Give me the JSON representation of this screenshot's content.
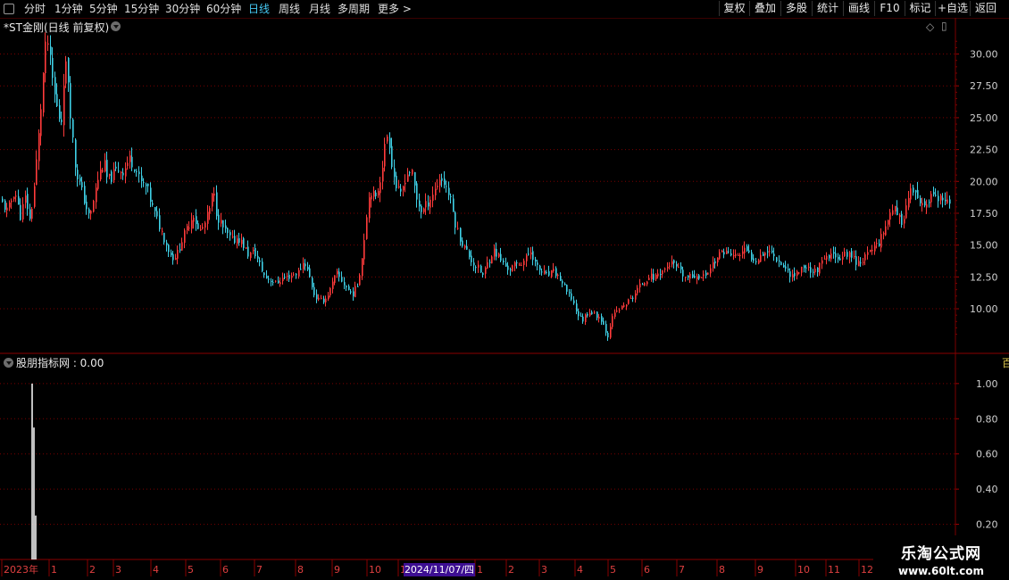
{
  "toolbar": {
    "periods": [
      "分时",
      "1分钟",
      "5分钟",
      "15分钟",
      "30分钟",
      "60分钟",
      "日线",
      "周线",
      "月线",
      "多周期",
      "更多 >"
    ],
    "active_period": "日线",
    "buttons": [
      "复权",
      "叠加",
      "多股",
      "统计",
      "画线",
      "F10",
      "标记",
      "+自选",
      "返回"
    ]
  },
  "main_panel": {
    "title": "*ST金刚(日线 前复权)"
  },
  "indicator_panel": {
    "title": "股朋指标网 : 0.00"
  },
  "right_strip": {
    "text": "百"
  },
  "time_axis": {
    "highlight": "2024/11/07/四"
  },
  "watermark": {
    "title": "乐淘公式网",
    "url": "www.60lt.com"
  },
  "colors": {
    "up": "#ff3b3b",
    "down": "#3fd0e6",
    "grid": "#7a0000",
    "axis_text": "#d0d0d0",
    "active": "#45c8f3"
  },
  "chart_data": [
    {
      "type": "candlestick",
      "title": "*ST金刚(日线 前复权)",
      "y_ticks": [
        10.0,
        12.5,
        15.0,
        17.5,
        20.0,
        22.5,
        25.0,
        27.5,
        30.0
      ],
      "ylim": [
        6.5,
        32
      ],
      "x_ticks": [
        "2023年",
        "1",
        "2",
        "3",
        "4",
        "5",
        "6",
        "7",
        "8",
        "9",
        "10",
        "1",
        "2024/11/07/四",
        "1",
        "2",
        "3",
        "4",
        "5",
        "6",
        "7",
        "8",
        "9",
        "10",
        "11",
        "12"
      ],
      "close_path": [
        [
          0,
          18.5
        ],
        [
          8,
          17.6
        ],
        [
          16,
          19.4
        ],
        [
          22,
          17.2
        ],
        [
          28,
          18.8
        ],
        [
          33,
          16.8
        ],
        [
          38,
          19.8
        ],
        [
          44,
          24.5
        ],
        [
          48,
          28.5
        ],
        [
          52,
          31.5
        ],
        [
          56,
          29
        ],
        [
          60,
          27
        ],
        [
          64,
          25.5
        ],
        [
          68,
          24.5
        ],
        [
          72,
          29.5
        ],
        [
          76,
          28
        ],
        [
          80,
          24
        ],
        [
          84,
          21
        ],
        [
          90,
          19.5
        ],
        [
          96,
          18
        ],
        [
          100,
          17
        ],
        [
          104,
          18.5
        ],
        [
          110,
          20.5
        ],
        [
          116,
          21.5
        ],
        [
          120,
          20
        ],
        [
          126,
          20.5
        ],
        [
          132,
          21
        ],
        [
          138,
          20.8
        ],
        [
          144,
          21.8
        ],
        [
          150,
          21.3
        ],
        [
          156,
          20
        ],
        [
          164,
          19.5
        ],
        [
          170,
          18
        ],
        [
          178,
          16.5
        ],
        [
          186,
          15
        ],
        [
          192,
          14
        ],
        [
          198,
          14.3
        ],
        [
          204,
          15.5
        ],
        [
          210,
          16.5
        ],
        [
          216,
          17.5
        ],
        [
          222,
          16
        ],
        [
          228,
          16.5
        ],
        [
          234,
          17.8
        ],
        [
          238,
          19.3
        ],
        [
          242,
          17.5
        ],
        [
          248,
          16.5
        ],
        [
          254,
          15.8
        ],
        [
          260,
          15.3
        ],
        [
          266,
          15.6
        ],
        [
          272,
          15
        ],
        [
          278,
          14.2
        ],
        [
          284,
          14.5
        ],
        [
          290,
          13.5
        ],
        [
          296,
          12.5
        ],
        [
          302,
          12.3
        ],
        [
          308,
          12
        ],
        [
          316,
          12.4
        ],
        [
          322,
          12.5
        ],
        [
          328,
          12.7
        ],
        [
          334,
          12.9
        ],
        [
          340,
          13.8
        ],
        [
          346,
          12.5
        ],
        [
          352,
          11
        ],
        [
          358,
          10.6
        ],
        [
          364,
          10.8
        ],
        [
          370,
          11.6
        ],
        [
          376,
          12.8
        ],
        [
          382,
          12.2
        ],
        [
          388,
          11.6
        ],
        [
          394,
          11.1
        ],
        [
          400,
          11.9
        ],
        [
          406,
          14.5
        ],
        [
          410,
          17.5
        ],
        [
          414,
          19.5
        ],
        [
          420,
          18.5
        ],
        [
          426,
          20.5
        ],
        [
          430,
          22.5
        ],
        [
          434,
          24
        ],
        [
          438,
          21.5
        ],
        [
          442,
          19.8
        ],
        [
          448,
          18.8
        ],
        [
          454,
          20.5
        ],
        [
          460,
          20.9
        ],
        [
          466,
          18.6
        ],
        [
          472,
          17.6
        ],
        [
          478,
          18.3
        ],
        [
          486,
          19.3
        ],
        [
          492,
          20.3
        ],
        [
          498,
          19.8
        ],
        [
          504,
          18.6
        ],
        [
          510,
          16.5
        ],
        [
          516,
          15.3
        ],
        [
          522,
          14.5
        ],
        [
          530,
          13.5
        ],
        [
          536,
          13.1
        ],
        [
          540,
          12.6
        ],
        [
          546,
          13.7
        ],
        [
          552,
          14.6
        ],
        [
          558,
          14.1
        ],
        [
          564,
          13.4
        ],
        [
          570,
          13.1
        ],
        [
          576,
          13.4
        ],
        [
          582,
          13.6
        ],
        [
          588,
          13.9
        ],
        [
          594,
          14.6
        ],
        [
          600,
          13.3
        ],
        [
          606,
          12.9
        ],
        [
          612,
          12.6
        ],
        [
          620,
          12.9
        ],
        [
          628,
          12.2
        ],
        [
          634,
          11.3
        ],
        [
          640,
          10.8
        ],
        [
          646,
          9.6
        ],
        [
          652,
          9.1
        ],
        [
          656,
          9.6
        ],
        [
          660,
          9.8
        ],
        [
          666,
          9.5
        ],
        [
          672,
          9.3
        ],
        [
          676,
          8.6
        ],
        [
          680,
          7.8
        ],
        [
          684,
          9.1
        ],
        [
          690,
          9.8
        ],
        [
          696,
          10.1
        ],
        [
          702,
          10.5
        ],
        [
          708,
          10.9
        ],
        [
          714,
          11.6
        ],
        [
          720,
          12.1
        ],
        [
          726,
          12.6
        ],
        [
          732,
          12.4
        ],
        [
          738,
          12.9
        ],
        [
          744,
          13.1
        ],
        [
          750,
          13.6
        ],
        [
          756,
          13.3
        ],
        [
          762,
          12.8
        ],
        [
          768,
          12.4
        ],
        [
          774,
          12.5
        ],
        [
          780,
          12.7
        ],
        [
          786,
          12.4
        ],
        [
          792,
          12.9
        ],
        [
          798,
          13.6
        ],
        [
          804,
          14.1
        ],
        [
          810,
          14.6
        ],
        [
          816,
          14.3
        ],
        [
          822,
          14.1
        ],
        [
          828,
          14.3
        ],
        [
          834,
          14.6
        ],
        [
          840,
          14.1
        ],
        [
          846,
          13.9
        ],
        [
          852,
          14.3
        ],
        [
          858,
          14.6
        ],
        [
          864,
          14.4
        ],
        [
          870,
          13.9
        ],
        [
          876,
          13.4
        ],
        [
          882,
          12.9
        ],
        [
          888,
          12.6
        ],
        [
          894,
          12.9
        ],
        [
          900,
          13.4
        ],
        [
          906,
          13.1
        ],
        [
          912,
          12.9
        ],
        [
          918,
          13.4
        ],
        [
          924,
          13.9
        ],
        [
          930,
          14.1
        ],
        [
          936,
          14.3
        ],
        [
          942,
          13.9
        ],
        [
          948,
          14.4
        ],
        [
          954,
          14.1
        ],
        [
          960,
          13.6
        ],
        [
          966,
          13.9
        ],
        [
          972,
          14.3
        ],
        [
          978,
          14.9
        ],
        [
          984,
          15.3
        ],
        [
          990,
          16.3
        ],
        [
          996,
          17.5
        ],
        [
          1000,
          18.2
        ],
        [
          1004,
          17.1
        ],
        [
          1010,
          16.9
        ],
        [
          1016,
          18.5
        ],
        [
          1020,
          19.3
        ],
        [
          1026,
          18.6
        ],
        [
          1032,
          17.9
        ],
        [
          1038,
          18.3
        ],
        [
          1044,
          18.9
        ],
        [
          1050,
          18.6
        ],
        [
          1056,
          18.4
        ],
        [
          1062,
          18.1
        ],
        [
          1065,
          17.6
        ]
      ],
      "up_color": "#ff3b3b",
      "down_color": "#3fd0e6"
    },
    {
      "type": "bar",
      "title": "股朋指标网 : 0.00",
      "y_ticks": [
        0.2,
        0.4,
        0.6,
        0.8,
        1.0
      ],
      "ylim": [
        0,
        1.05
      ],
      "spikes": [
        {
          "x": 36,
          "value": 1.0
        },
        {
          "x": 38,
          "value": 0.75
        },
        {
          "x": 40,
          "value": 0.25
        }
      ]
    }
  ]
}
